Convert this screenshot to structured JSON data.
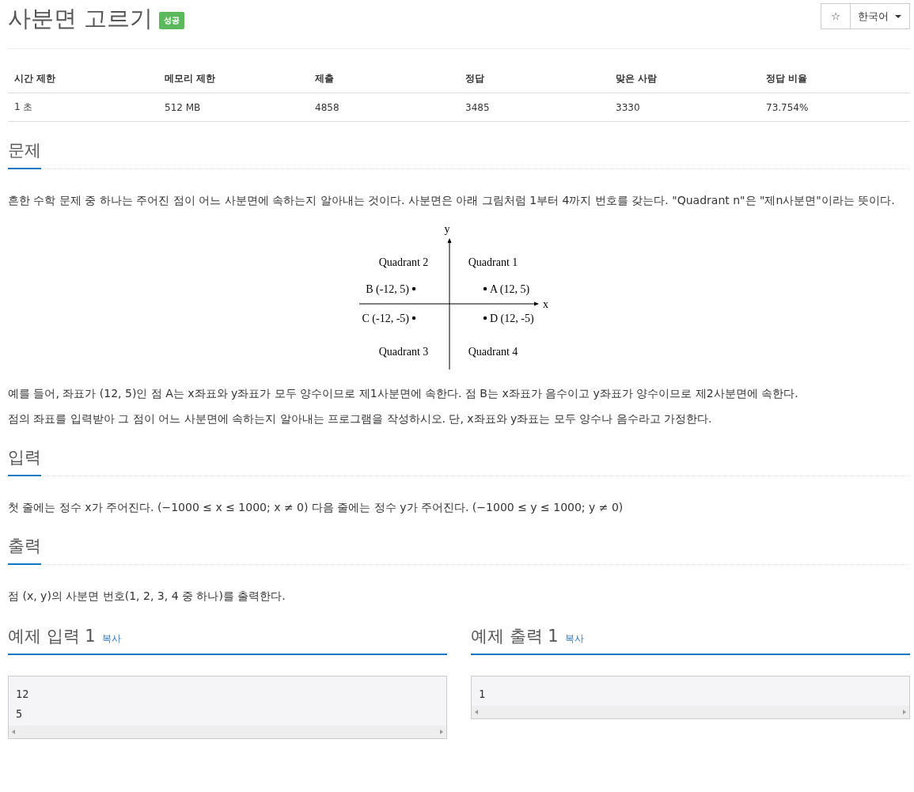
{
  "title": "사분면 고르기",
  "result_badge": "성공",
  "star_button": "☆",
  "language_button": "한국어",
  "info_table": {
    "columns": [
      "시간 제한",
      "메모리 제한",
      "제출",
      "정답",
      "맞은 사람",
      "정답 비율"
    ],
    "rows": [
      [
        "1 초",
        "512 MB",
        "4858",
        "3485",
        "3330",
        "73.754%"
      ]
    ]
  },
  "sections": [
    {
      "heading": "문제",
      "paragraphs": [
        "흔한 수학 문제 중 하나는 주어진 점이 어느 사분면에 속하는지 알아내는 것이다. 사분면은 아래 그림처럼 1부터 4까지 번호를 갖는다. \"Quadrant n\"은 \"제n사분면\"이라는 뜻이다."
      ],
      "figure": {
        "y_axis_label": "y",
        "x_axis_label": "x",
        "quadrant_labels": [
          "Quadrant 2",
          "Quadrant 1",
          "Quadrant 3",
          "Quadrant 4"
        ],
        "points": [
          "B (-12, 5)",
          "A (12, 5)",
          "C (-12, -5)",
          "D (12, -5)"
        ]
      },
      "paragraphs_after": [
        "예를 들어, 좌표가 (12, 5)인 점 A는 x좌표와 y좌표가 모두 양수이므로 제1사분면에 속한다. 점 B는 x좌표가 음수이고 y좌표가 양수이므로 제2사분면에 속한다.",
        "점의 좌표를 입력받아 그 점이 어느 사분면에 속하는지 알아내는 프로그램을 작성하시오. 단, x좌표와 y좌표는 모두 양수나 음수라고 가정한다."
      ]
    },
    {
      "heading": "입력",
      "paragraphs": [
        "첫 줄에는 정수 x가 주어진다. (−1000 ≤ x ≤ 1000; x ≠ 0) 다음 줄에는 정수 y가 주어진다. (−1000 ≤ y ≤ 1000; y ≠ 0)"
      ]
    },
    {
      "heading": "출력",
      "paragraphs": [
        "점 (x, y)의 사분면 번호(1, 2, 3, 4 중 하나)를 출력한다."
      ]
    }
  ],
  "samples": [
    {
      "heading": "예제 입력 1",
      "copy_link": "복사",
      "lines": [
        "12",
        "5"
      ]
    },
    {
      "heading": "예제 출력 1",
      "copy_link": "복사",
      "lines": [
        "1"
      ]
    }
  ]
}
